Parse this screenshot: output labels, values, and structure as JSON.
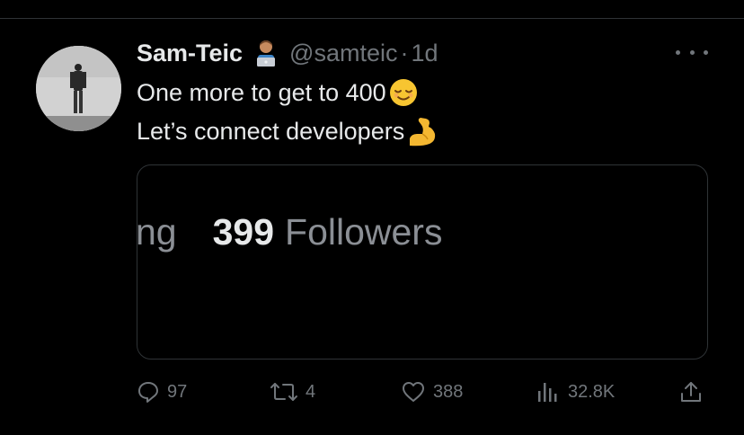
{
  "tweet": {
    "author_name": "Sam-Teic",
    "name_emoji": "technologist-emoji",
    "handle": "@samteic",
    "separator": "·",
    "time": "1d",
    "text_line1": "One more to get to 400",
    "text_line1_emoji": "relieved-face-emoji",
    "text_line2": "Let’s connect developers",
    "text_line2_emoji": "flexed-biceps-emoji"
  },
  "media": {
    "prev_fragment": "ng",
    "followers_count": "399",
    "followers_label": "Followers"
  },
  "actions": {
    "replies": "97",
    "retweets": "4",
    "likes": "388",
    "views": "32.8K"
  },
  "colors": {
    "background": "#000000",
    "text": "#e7e9ea",
    "muted": "#71767b",
    "border": "#2f3336"
  }
}
